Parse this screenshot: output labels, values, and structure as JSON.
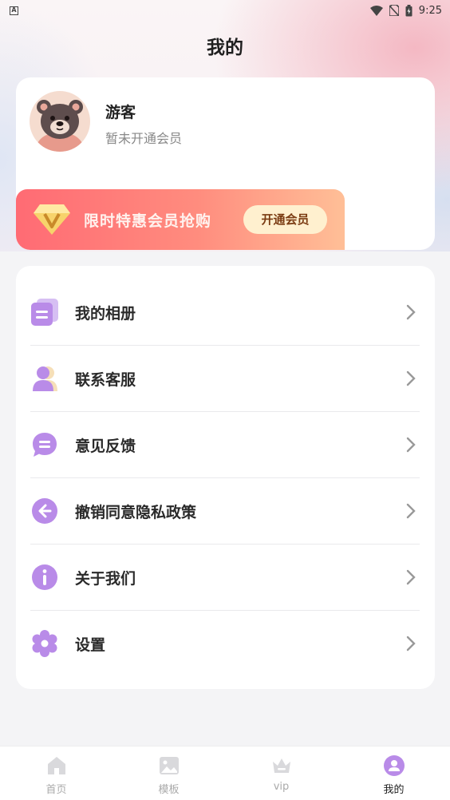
{
  "status_bar": {
    "time": "9:25",
    "left_icon": "A"
  },
  "header": {
    "title": "我的"
  },
  "profile": {
    "name": "游客",
    "membership_status": "暂未开通会员",
    "avatar": "bear-avatar"
  },
  "vip_banner": {
    "text": "限时特惠会员抢购",
    "button": "开通会员"
  },
  "menu": [
    {
      "label": "我的相册",
      "icon": "album-icon"
    },
    {
      "label": "联系客服",
      "icon": "customer-service-icon"
    },
    {
      "label": "意见反馈",
      "icon": "feedback-icon"
    },
    {
      "label": "撤销同意隐私政策",
      "icon": "revoke-icon"
    },
    {
      "label": "关于我们",
      "icon": "info-icon"
    },
    {
      "label": "设置",
      "icon": "settings-icon"
    }
  ],
  "tabs": [
    {
      "label": "首页",
      "icon": "home-icon",
      "active": false
    },
    {
      "label": "模板",
      "icon": "template-icon",
      "active": false
    },
    {
      "label": "vip",
      "icon": "crown-icon",
      "active": false
    },
    {
      "label": "我的",
      "icon": "profile-icon",
      "active": true
    }
  ],
  "colors": {
    "accent": "#b98be8",
    "vip_gradient_start": "#ff6b74",
    "vip_gradient_end": "#ffbf97"
  }
}
